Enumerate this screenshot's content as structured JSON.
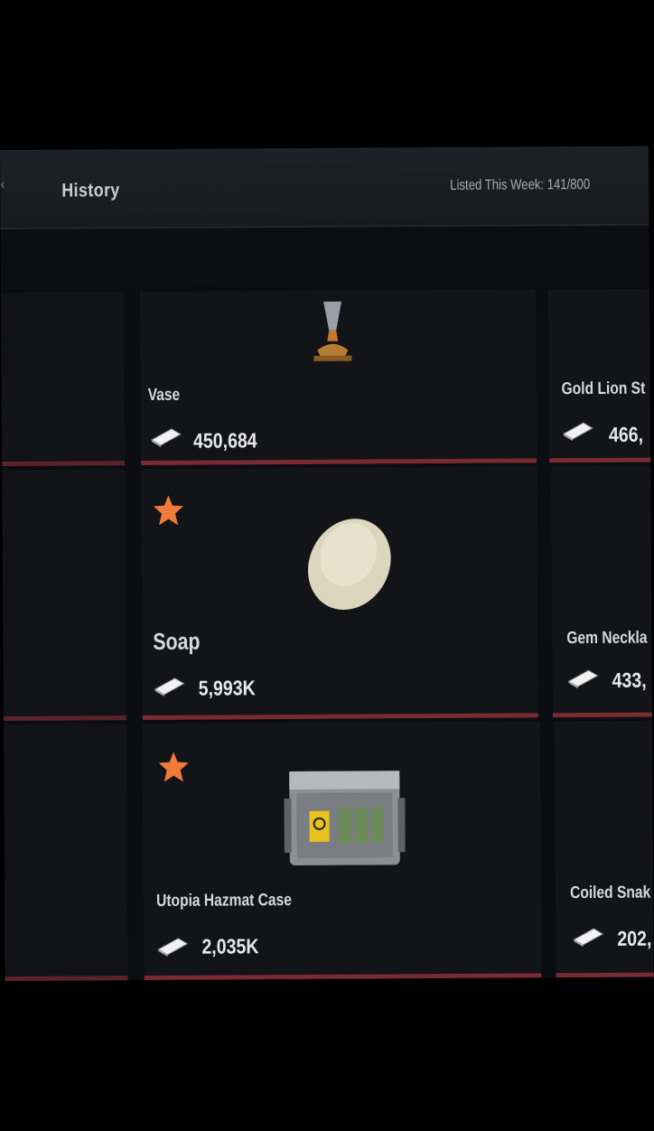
{
  "header": {
    "back_glyph": "‹",
    "title": "History",
    "listed_this_week": "Listed This Week: 141/800"
  },
  "colors": {
    "accent_bar": "#7a2a33",
    "favorite_star": "#f07a3a",
    "background": "#0c0d10"
  },
  "items": [
    {
      "name": "Vase",
      "price": "450,684",
      "favorite": false,
      "icon": "vase-icon"
    },
    {
      "name": "Gold Lion St",
      "price": "466,",
      "favorite": false,
      "icon": "lion-statue-icon"
    },
    {
      "name": "Soap",
      "price": "5,993K",
      "favorite": true,
      "icon": "soap-icon"
    },
    {
      "name": "Gem Neckla",
      "price": "433,",
      "favorite": false,
      "icon": "necklace-icon"
    },
    {
      "name": "Utopia Hazmat Case",
      "price": "2,035K",
      "favorite": true,
      "icon": "hazmat-case-icon"
    },
    {
      "name": "Coiled Snak",
      "price": "202,",
      "favorite": false,
      "icon": "snake-icon"
    }
  ]
}
